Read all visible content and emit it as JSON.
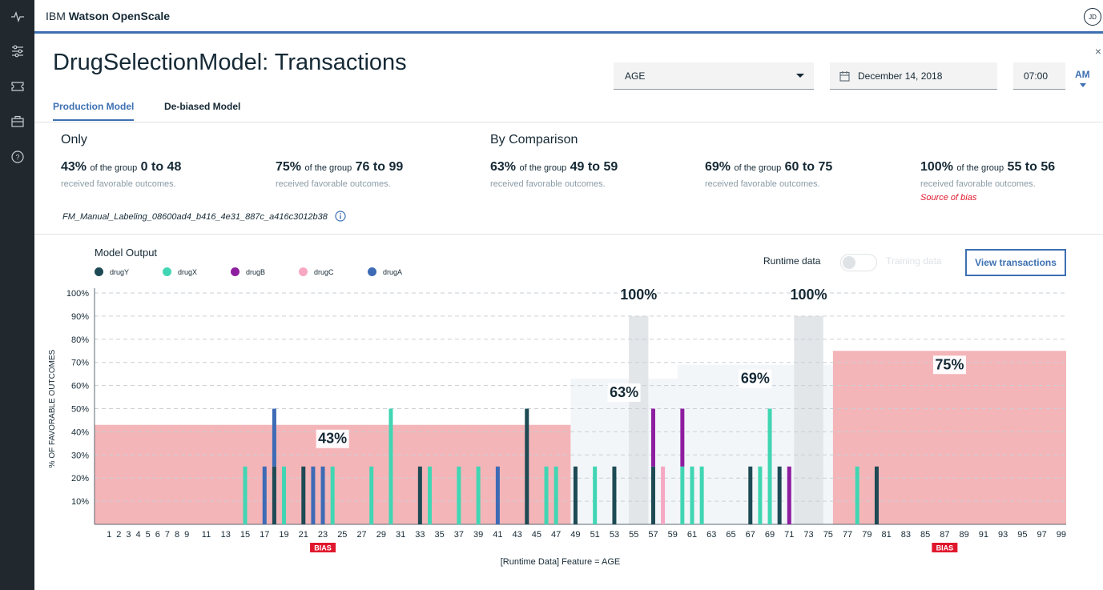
{
  "app": {
    "brand_prefix": "IBM",
    "brand_name": "Watson OpenScale",
    "avatar": "JD"
  },
  "page": {
    "title": "DrugSelectionModel: Transactions",
    "close": "×"
  },
  "sidebar": {
    "icons": [
      "activity-icon",
      "sliders-icon",
      "ticket-icon",
      "briefcase-icon",
      "help-icon"
    ]
  },
  "filters": {
    "feature": "AGE",
    "date": "December 14, 2018",
    "time": "07:00",
    "ampm": "AM"
  },
  "tabs": [
    {
      "label": "Production Model",
      "active": true
    },
    {
      "label": "De-biased Model",
      "active": false
    }
  ],
  "summary": {
    "only_title": "Only",
    "comparison_title": "By Comparison",
    "of_the_group": "of the group",
    "received": "received favorable outcomes.",
    "source_of_bias": "Source of bias",
    "stats": [
      {
        "pct": "43%",
        "group": "0 to 48"
      },
      {
        "pct": "75%",
        "group": "76 to 99"
      },
      {
        "pct": "63%",
        "group": "49 to 59"
      },
      {
        "pct": "69%",
        "group": "60 to 75"
      },
      {
        "pct": "100%",
        "group": "55 to 56"
      }
    ],
    "run_id": "FM_Manual_Labeling_08600ad4_b416_4e31_887c_a416c3012b38"
  },
  "model_output": {
    "title": "Model Output",
    "runtime_label": "Runtime data",
    "training_label": "Training data",
    "view_button": "View transactions"
  },
  "colors": {
    "drugY": "#1d4a54",
    "drugX": "#41d6b3",
    "drugB": "#8e1ea0",
    "drugC": "#f7a7c2",
    "drugA": "#3d6bb5",
    "bias_band": "#f4b5b8",
    "compare_band": "#f3f6f9",
    "highlight_band": "#e2e6e9",
    "bias_tag": "#e0182d"
  },
  "chart_data": {
    "type": "bar",
    "ylabel": "% OF FAVORABLE OUTCOMES",
    "xlabel": "[Runtime Data] Feature = AGE",
    "ylim": [
      0,
      100
    ],
    "yticks": [
      "10%",
      "20%",
      "30%",
      "40%",
      "50%",
      "60%",
      "70%",
      "80%",
      "90%",
      "100%"
    ],
    "xticks": [
      1,
      2,
      3,
      4,
      5,
      6,
      7,
      8,
      9,
      11,
      13,
      15,
      17,
      19,
      21,
      23,
      25,
      27,
      29,
      31,
      33,
      35,
      37,
      39,
      41,
      43,
      45,
      47,
      49,
      51,
      53,
      55,
      57,
      59,
      61,
      63,
      65,
      67,
      69,
      71,
      73,
      75,
      77,
      79,
      81,
      83,
      85,
      87,
      89,
      91,
      93,
      95,
      97,
      99
    ],
    "bias_tag": "BIAS",
    "bias_tag_positions": [
      23,
      87
    ],
    "legend": [
      "drugY",
      "drugX",
      "drugB",
      "drugC",
      "drugA"
    ],
    "bands": [
      {
        "kind": "bias",
        "from": 0,
        "to": 48,
        "value": 43,
        "label": "43%"
      },
      {
        "kind": "compare",
        "from": 49,
        "to": 59,
        "value": 63,
        "label": "63%"
      },
      {
        "kind": "compare",
        "from": 60,
        "to": 75,
        "value": 69,
        "label": "69%"
      },
      {
        "kind": "bias",
        "from": 76,
        "to": 99,
        "value": 75,
        "label": "75%"
      },
      {
        "kind": "highlight",
        "from": 55,
        "to": 56,
        "value": 90,
        "label": "100%"
      },
      {
        "kind": "highlight",
        "from": 72,
        "to": 74,
        "value": 90,
        "label": "100%"
      }
    ],
    "bars": [
      {
        "age": 15,
        "segs": [
          [
            "drugX",
            25
          ]
        ]
      },
      {
        "age": 17,
        "segs": [
          [
            "drugA",
            25
          ]
        ]
      },
      {
        "age": 18,
        "segs": [
          [
            "drugY",
            25
          ],
          [
            "drugA",
            25
          ]
        ]
      },
      {
        "age": 19,
        "segs": [
          [
            "drugX",
            25
          ]
        ]
      },
      {
        "age": 21,
        "segs": [
          [
            "drugY",
            25
          ]
        ]
      },
      {
        "age": 22,
        "segs": [
          [
            "drugA",
            25
          ]
        ]
      },
      {
        "age": 23,
        "segs": [
          [
            "drugA",
            25
          ]
        ]
      },
      {
        "age": 24,
        "segs": [
          [
            "drugX",
            25
          ]
        ]
      },
      {
        "age": 28,
        "segs": [
          [
            "drugX",
            25
          ]
        ]
      },
      {
        "age": 30,
        "segs": [
          [
            "drugX",
            50
          ]
        ]
      },
      {
        "age": 33,
        "segs": [
          [
            "drugY",
            25
          ]
        ]
      },
      {
        "age": 34,
        "segs": [
          [
            "drugX",
            25
          ]
        ]
      },
      {
        "age": 37,
        "segs": [
          [
            "drugX",
            25
          ]
        ]
      },
      {
        "age": 39,
        "segs": [
          [
            "drugX",
            25
          ]
        ]
      },
      {
        "age": 41,
        "segs": [
          [
            "drugA",
            25
          ]
        ]
      },
      {
        "age": 44,
        "segs": [
          [
            "drugY",
            50
          ]
        ]
      },
      {
        "age": 46,
        "segs": [
          [
            "drugX",
            25
          ]
        ]
      },
      {
        "age": 47,
        "segs": [
          [
            "drugX",
            25
          ]
        ]
      },
      {
        "age": 49,
        "segs": [
          [
            "drugY",
            25
          ]
        ]
      },
      {
        "age": 51,
        "segs": [
          [
            "drugX",
            25
          ]
        ]
      },
      {
        "age": 53,
        "segs": [
          [
            "drugY",
            25
          ]
        ]
      },
      {
        "age": 57,
        "segs": [
          [
            "drugY",
            25
          ],
          [
            "drugB",
            25
          ]
        ]
      },
      {
        "age": 58,
        "segs": [
          [
            "drugC",
            25
          ]
        ]
      },
      {
        "age": 60,
        "segs": [
          [
            "drugX",
            25
          ],
          [
            "drugB",
            25
          ]
        ]
      },
      {
        "age": 61,
        "segs": [
          [
            "drugX",
            25
          ]
        ]
      },
      {
        "age": 62,
        "segs": [
          [
            "drugX",
            25
          ]
        ]
      },
      {
        "age": 67,
        "segs": [
          [
            "drugY",
            25
          ]
        ]
      },
      {
        "age": 68,
        "segs": [
          [
            "drugX",
            25
          ]
        ]
      },
      {
        "age": 69,
        "segs": [
          [
            "drugX",
            50
          ]
        ]
      },
      {
        "age": 70,
        "segs": [
          [
            "drugY",
            25
          ]
        ]
      },
      {
        "age": 71,
        "segs": [
          [
            "drugB",
            25
          ]
        ]
      },
      {
        "age": 78,
        "segs": [
          [
            "drugX",
            25
          ]
        ]
      },
      {
        "age": 80,
        "segs": [
          [
            "drugY",
            25
          ]
        ]
      }
    ]
  }
}
